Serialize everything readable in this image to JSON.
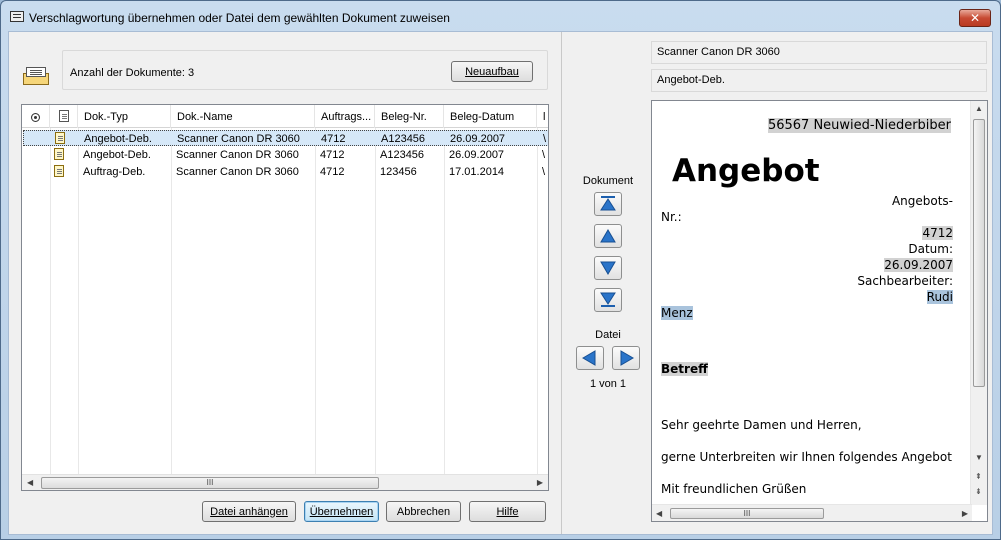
{
  "window": {
    "title": "Verschlagwortung übernehmen oder Datei dem gewählten Dokument zuweisen",
    "close_glyph": "✕"
  },
  "left": {
    "count_label": "Anzahl der Dokumente: 3",
    "rebuild_button": "Neuaufbau",
    "columns": [
      "Dok.-Typ",
      "Dok.-Name",
      "Auftrags...",
      "Beleg-Nr.",
      "Beleg-Datum",
      "l"
    ],
    "rows": [
      {
        "typ": "Angebot-Deb.",
        "name": "Scanner Canon DR 3060",
        "auftrag": "4712",
        "beleg": "A123456",
        "datum": "26.09.2007",
        "extra": "\\",
        "selected": true
      },
      {
        "typ": "Angebot-Deb.",
        "name": "Scanner Canon DR 3060",
        "auftrag": "4712",
        "beleg": "A123456",
        "datum": "26.09.2007",
        "extra": "\\",
        "selected": false
      },
      {
        "typ": "Auftrag-Deb.",
        "name": "Scanner Canon DR 3060",
        "auftrag": "4712",
        "beleg": "123456",
        "datum": "17.01.2014",
        "extra": "\\",
        "selected": false
      }
    ],
    "scroll_grip": "III"
  },
  "buttons": {
    "attach": "Datei anhängen",
    "apply": "Übernehmen",
    "cancel": "Abbrechen",
    "help": "Hilfe"
  },
  "nav": {
    "document_label": "Dokument",
    "file_label": "Datei",
    "page_info": "1 von 1"
  },
  "right": {
    "info1": "Scanner Canon DR 3060",
    "info2": "Angebot-Deb.",
    "preview": {
      "address": "56567 Neuwied-Niederbiber",
      "heading": "Angebot",
      "l1": "Angebots-",
      "l2": "Nr.:",
      "l3": "4712",
      "l4": "Datum:",
      "l5": "26.09.2007",
      "l6": "Sachbearbeiter:",
      "l7": "Rudi",
      "l8": "Menz",
      "subject": "Betreff",
      "salutation": "Sehr geehrte Damen und Herren,",
      "body": "gerne Unterbreiten wir Ihnen folgendes Angebot",
      "closing": "Mit freundlichen Grüßen"
    },
    "scroll_grip": "III"
  }
}
